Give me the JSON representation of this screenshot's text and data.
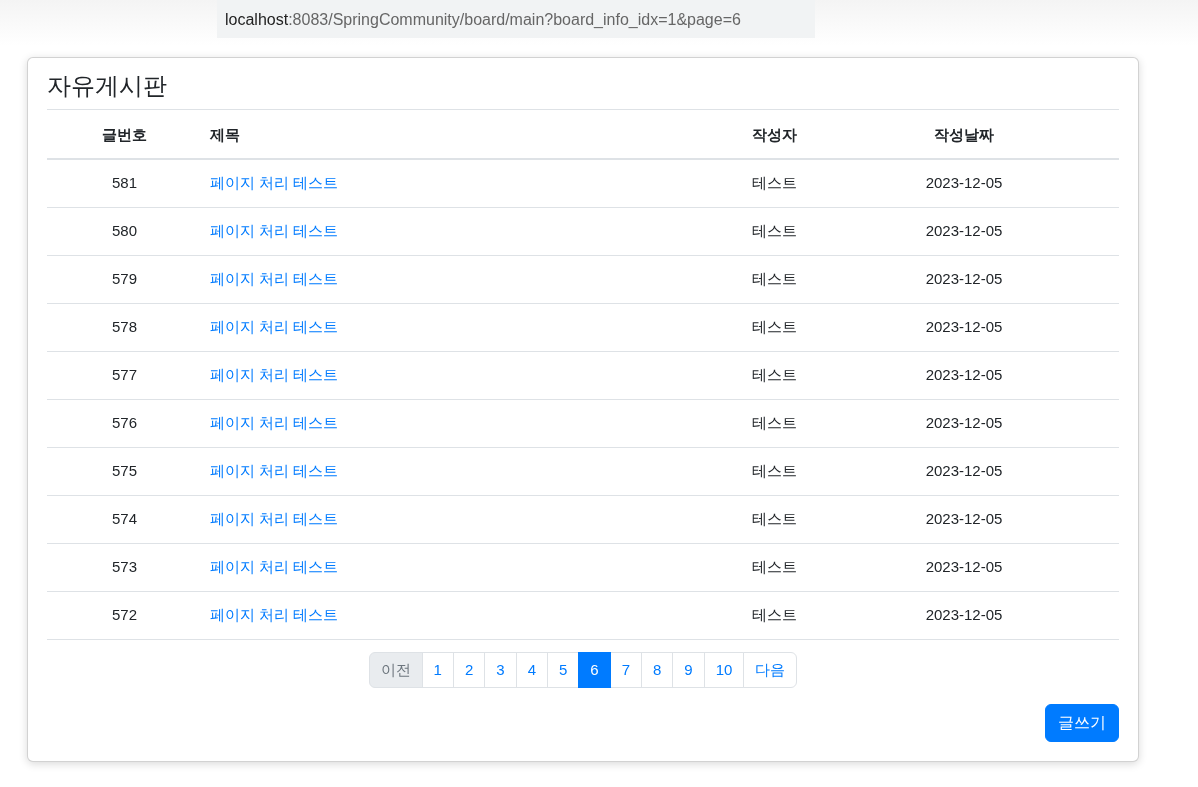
{
  "address_bar": {
    "host": "localhost",
    "path": ":8083/SpringCommunity/board/main?board_info_idx=1&page=6"
  },
  "board": {
    "title": "자유게시판",
    "columns": [
      "글번호",
      "제목",
      "작성자",
      "작성날짜"
    ],
    "rows": [
      {
        "number": "581",
        "title": "페이지 처리 테스트",
        "author": "테스트",
        "date": "2023-12-05"
      },
      {
        "number": "580",
        "title": "페이지 처리 테스트",
        "author": "테스트",
        "date": "2023-12-05"
      },
      {
        "number": "579",
        "title": "페이지 처리 테스트",
        "author": "테스트",
        "date": "2023-12-05"
      },
      {
        "number": "578",
        "title": "페이지 처리 테스트",
        "author": "테스트",
        "date": "2023-12-05"
      },
      {
        "number": "577",
        "title": "페이지 처리 테스트",
        "author": "테스트",
        "date": "2023-12-05"
      },
      {
        "number": "576",
        "title": "페이지 처리 테스트",
        "author": "테스트",
        "date": "2023-12-05"
      },
      {
        "number": "575",
        "title": "페이지 처리 테스트",
        "author": "테스트",
        "date": "2023-12-05"
      },
      {
        "number": "574",
        "title": "페이지 처리 테스트",
        "author": "테스트",
        "date": "2023-12-05"
      },
      {
        "number": "573",
        "title": "페이지 처리 테스트",
        "author": "테스트",
        "date": "2023-12-05"
      },
      {
        "number": "572",
        "title": "페이지 처리 테스트",
        "author": "테스트",
        "date": "2023-12-05"
      }
    ],
    "pagination": [
      {
        "label": "이전",
        "selected": false,
        "disabled": true
      },
      {
        "label": "1",
        "selected": false,
        "disabled": false
      },
      {
        "label": "2",
        "selected": false,
        "disabled": false
      },
      {
        "label": "3",
        "selected": false,
        "disabled": false
      },
      {
        "label": "4",
        "selected": false,
        "disabled": false
      },
      {
        "label": "5",
        "selected": false,
        "disabled": false
      },
      {
        "label": "6",
        "selected": true,
        "disabled": false
      },
      {
        "label": "7",
        "selected": false,
        "disabled": false
      },
      {
        "label": "8",
        "selected": false,
        "disabled": false
      },
      {
        "label": "9",
        "selected": false,
        "disabled": false
      },
      {
        "label": "10",
        "selected": false,
        "disabled": false
      },
      {
        "label": "다음",
        "selected": false,
        "disabled": false
      }
    ],
    "write_button": "글쓰기"
  }
}
